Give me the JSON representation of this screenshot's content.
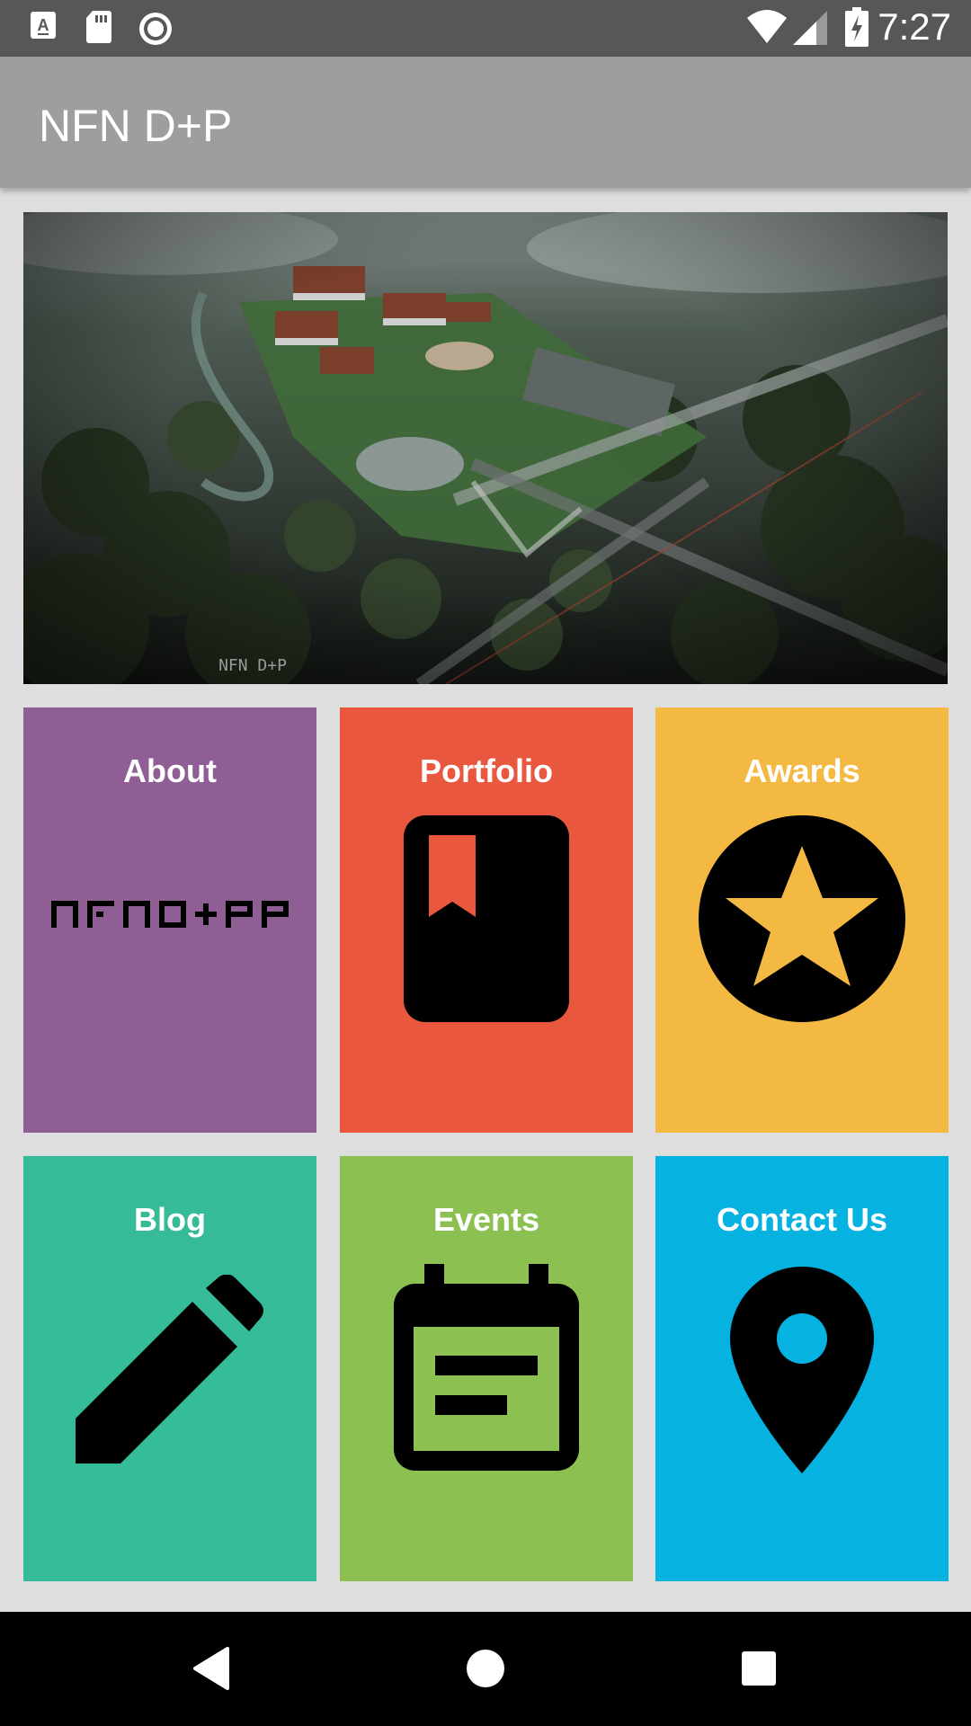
{
  "status_bar": {
    "time": "7:27",
    "left_icons": [
      "notification-a-icon",
      "sd-card-icon",
      "record-icon"
    ],
    "right_icons": [
      "wifi-icon",
      "cell-signal-icon",
      "battery-charging-icon"
    ]
  },
  "app_bar": {
    "title": "NFN D+P"
  },
  "hero": {
    "watermark": "NFN D+P"
  },
  "tiles": [
    {
      "label": "About",
      "color": "#8e5e94",
      "icon": "nfndp-logo"
    },
    {
      "label": "Portfolio",
      "color": "#e9573f",
      "icon": "book-bookmark-icon"
    },
    {
      "label": "Awards",
      "color": "#f4b942",
      "icon": "star-circle-icon"
    },
    {
      "label": "Blog",
      "color": "#36bb98",
      "icon": "pencil-icon"
    },
    {
      "label": "Events",
      "color": "#8cc152",
      "icon": "calendar-event-icon"
    },
    {
      "label": "Contact Us",
      "color": "#05b2e0",
      "icon": "location-pin-icon"
    }
  ],
  "nav_bar": {
    "buttons": [
      "back-icon",
      "home-icon",
      "recents-icon"
    ]
  }
}
